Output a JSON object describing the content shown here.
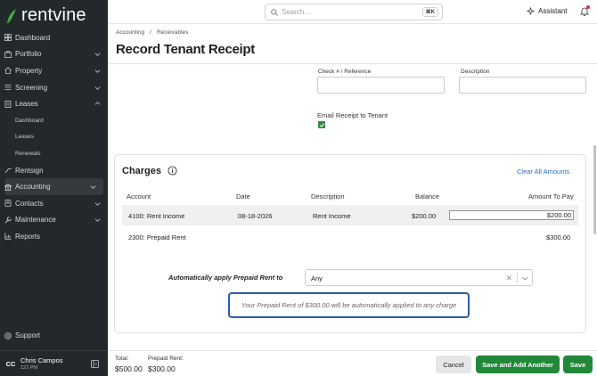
{
  "brand": {
    "name": "rentvine"
  },
  "sidebar": {
    "items": [
      {
        "label": "Dashboard",
        "icon": "dashboard-icon",
        "chevron": ""
      },
      {
        "label": "Portfolio",
        "icon": "portfolio-icon",
        "chevron": "down"
      },
      {
        "label": "Property",
        "icon": "property-icon",
        "chevron": "down"
      },
      {
        "label": "Screening",
        "icon": "screening-icon",
        "chevron": "down"
      },
      {
        "label": "Leases",
        "icon": "leases-icon",
        "chevron": "up"
      }
    ],
    "lease_subitems": [
      "Dashboard",
      "Leases",
      "Renewals"
    ],
    "items2": [
      {
        "label": "Rentsign",
        "icon": "rentsign-icon",
        "chevron": ""
      },
      {
        "label": "Accounting",
        "icon": "accounting-icon",
        "chevron": "down",
        "active": true
      },
      {
        "label": "Contacts",
        "icon": "contacts-icon",
        "chevron": "down"
      },
      {
        "label": "Maintenance",
        "icon": "maintenance-icon",
        "chevron": "down"
      },
      {
        "label": "Reports",
        "icon": "reports-icon",
        "chevron": ""
      }
    ],
    "support_label": "Support",
    "user": {
      "initials": "CC",
      "name": "Chris Campos",
      "meta": "123 PM"
    }
  },
  "topbar": {
    "search_placeholder": "Search...",
    "shortcut": "⌘K",
    "assistant_label": "Assistant"
  },
  "breadcrumb": [
    "Accounting",
    "Receivables"
  ],
  "breadcrumb_sep": "/",
  "page_title": "Record Tenant Receipt",
  "form": {
    "check_label": "Check # / Reference",
    "check_value": "",
    "description_label": "Description",
    "description_value": "",
    "email_receipt_label": "Email Receipt to Tenant",
    "email_receipt_checked": true
  },
  "charges": {
    "title": "Charges",
    "clear_label": "Clear All Amounts",
    "columns": [
      "Account",
      "Date",
      "Description",
      "Balance",
      "Amount To Pay"
    ],
    "rows": [
      {
        "account": "4100: Rent Income",
        "date": "08-18-2026",
        "description": "Rent Income",
        "balance": "$200.00",
        "amount": "$200.00"
      }
    ],
    "prepaid": {
      "account": "2300: Prepaid Rent",
      "amount": "$300.00"
    },
    "apply_label": "Automatically apply Prepaid Rent to",
    "apply_value": "Any",
    "note": "Your Prepaid Rent of $300.00 will be automatically applied to any charge"
  },
  "footer": {
    "total_label": "Total:",
    "total_value": "$500.00",
    "prepaid_label": "Prepaid Rent:",
    "prepaid_value": "$300.00",
    "cancel_label": "Cancel",
    "save_another_label": "Save and Add Another",
    "save_label": "Save"
  },
  "colors": {
    "sidebar_bg": "#23282b",
    "accent_green": "#218739",
    "link_blue": "#2a6fc4",
    "note_border": "#2a5db0"
  }
}
